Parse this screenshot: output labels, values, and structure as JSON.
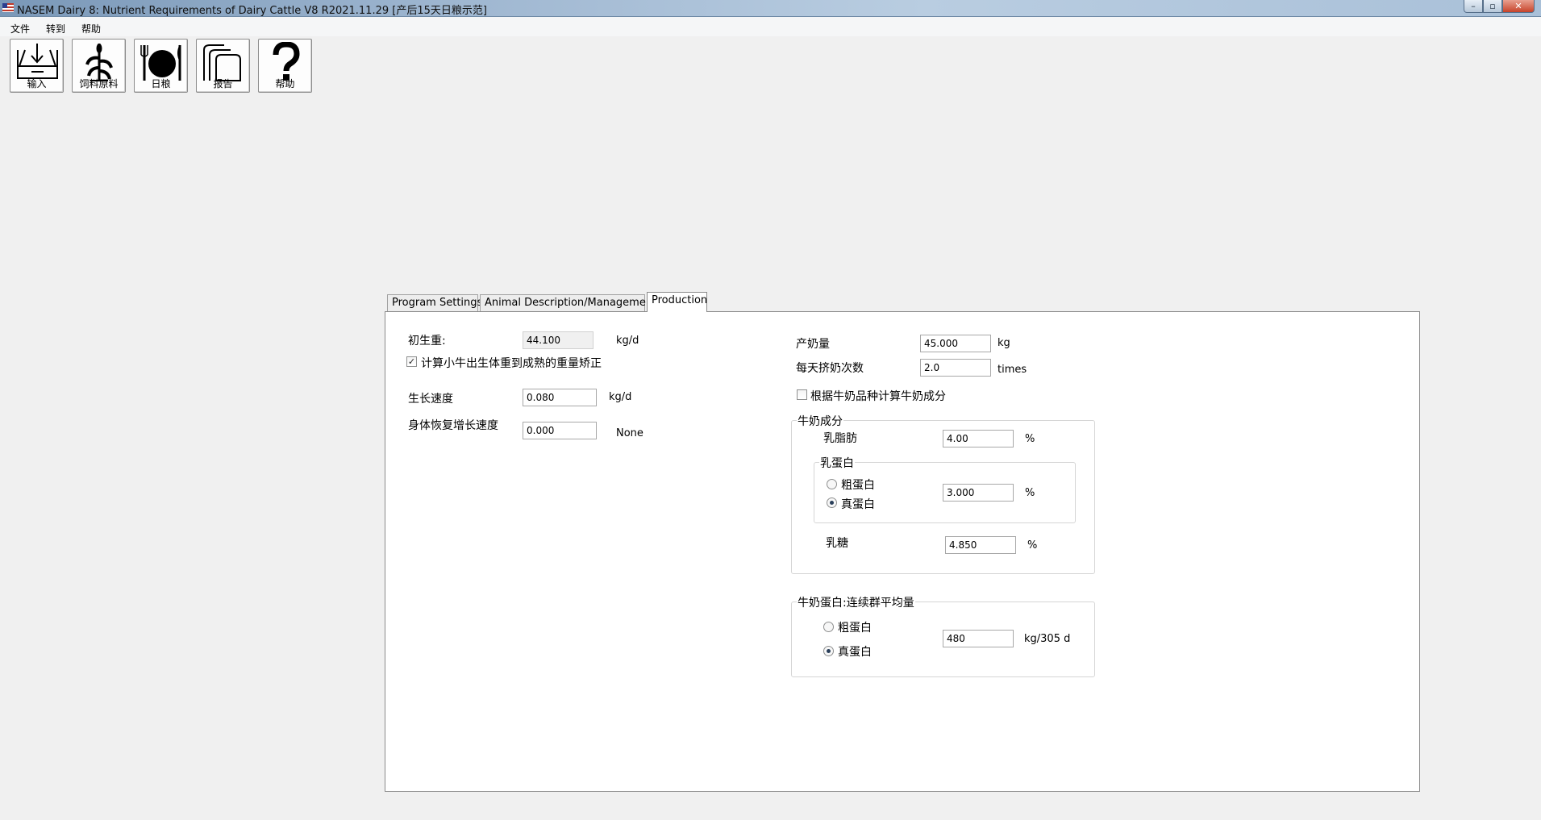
{
  "window": {
    "title": "NASEM Dairy 8: Nutrient Requirements of Dairy Cattle  V8 R2021.11.29 [产后15天日粮示范]",
    "controls": {
      "minimize": "–",
      "maximize": "▫",
      "close": "✕"
    }
  },
  "menu": {
    "items": [
      "文件",
      "转到",
      "帮助"
    ]
  },
  "toolbar": {
    "buttons": [
      {
        "label": "输入",
        "icon": "input-tray-icon"
      },
      {
        "label": "饲料原料",
        "icon": "corn-plant-icon"
      },
      {
        "label": "日粮",
        "icon": "plate-fork-knife-icon"
      },
      {
        "label": "报告",
        "icon": "stacked-pages-icon"
      },
      {
        "label": "帮助",
        "icon": "question-mark-icon"
      }
    ]
  },
  "tabs": [
    {
      "label": "Program Settings",
      "active": false
    },
    {
      "label": "Animal Description/Management",
      "active": false
    },
    {
      "label": "Production",
      "active": true
    }
  ],
  "production": {
    "birth_weight": {
      "label": "初生重:",
      "value": "44.100",
      "unit": "kg/d"
    },
    "calc_birth_weight": {
      "label": "计算小牛出生体重到成熟的重量矫正",
      "checked": true,
      "mark": "✓"
    },
    "growth_rate": {
      "label": "生长速度",
      "value": "0.080",
      "unit": "kg/d"
    },
    "recovery_growth": {
      "label": "身体恢复增长速度",
      "value": "0.000",
      "unit": "None"
    },
    "milk_yield": {
      "label": "产奶量",
      "value": "45.000",
      "unit": "kg"
    },
    "milkings_per_day": {
      "label": "每天挤奶次数",
      "value": "2.0",
      "unit": "times"
    },
    "calc_by_breed": {
      "label": "根据牛奶品种计算牛奶成分",
      "checked": false
    },
    "milk_components": {
      "title": "牛奶成分",
      "fat": {
        "label": "乳脂肪",
        "value": "4.00",
        "unit": "%"
      },
      "protein": {
        "title": "乳蛋白",
        "crude": {
          "label": "粗蛋白",
          "selected": false
        },
        "true": {
          "label": "真蛋白",
          "selected": true
        },
        "value": "3.000",
        "unit": "%"
      },
      "lactose": {
        "label": "乳糖",
        "value": "4.850",
        "unit": "%"
      }
    },
    "herd_protein": {
      "title": "牛奶蛋白:连续群平均量",
      "crude": {
        "label": "粗蛋白",
        "selected": false
      },
      "true": {
        "label": "真蛋白",
        "selected": true
      },
      "value": "480",
      "unit": "kg/305 d"
    }
  }
}
